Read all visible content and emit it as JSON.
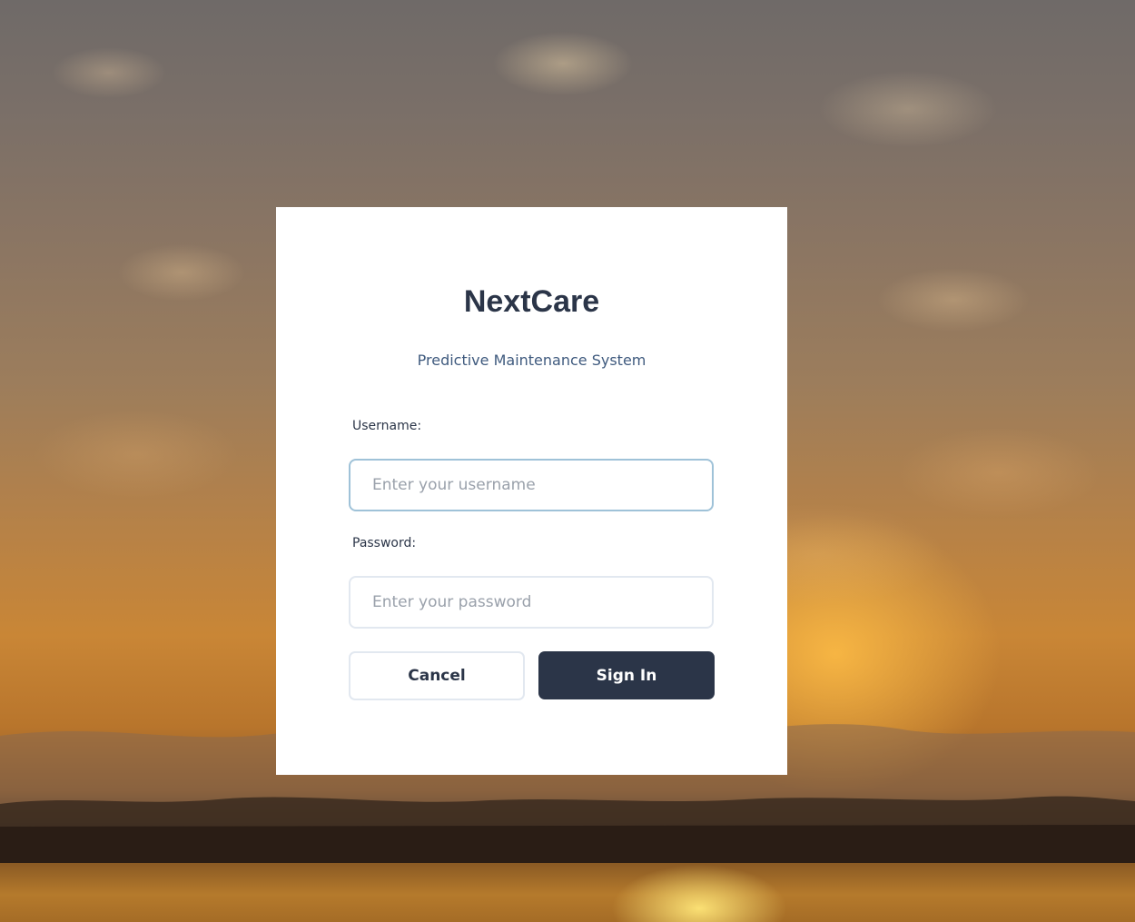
{
  "colors": {
    "card_background": "#ffffff",
    "primary_dark": "#2b3548",
    "subtitle_blue": "#3f5a7e",
    "input_border": "#e2e8f0",
    "input_focus_border": "#9fc2d8",
    "placeholder": "#9aa1ab"
  },
  "background": {
    "description_icon": "sunset-landscape-image"
  },
  "login": {
    "title": "NextCare",
    "subtitle": "Predictive Maintenance System",
    "username": {
      "label": "Username:",
      "placeholder": "Enter your username",
      "value": ""
    },
    "password": {
      "label": "Password:",
      "placeholder": "Enter your password",
      "value": ""
    },
    "cancel_label": "Cancel",
    "signin_label": "Sign In"
  }
}
